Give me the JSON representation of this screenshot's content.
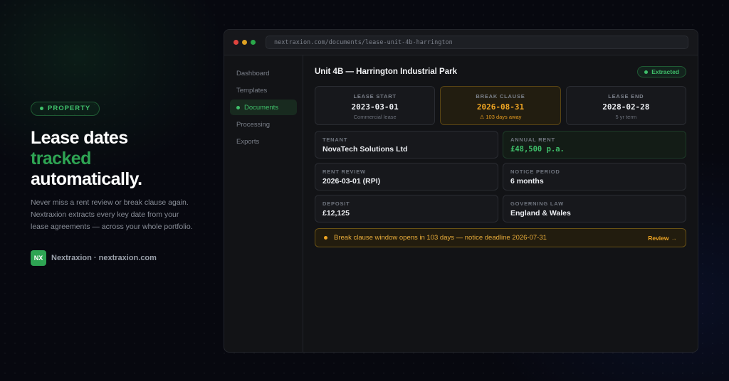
{
  "hero": {
    "badge": "PROPERTY",
    "headline_1": "Lease dates",
    "headline_2": "tracked",
    "headline_3": "automatically.",
    "description": "Never miss a rent review or break clause again. Nextraxion extracts every key date from your lease agreements — across your whole portfolio.",
    "logo_text": "NX",
    "brand": "Nextraxion · nextraxion.com"
  },
  "browser": {
    "url": "nextraxion.com/documents/lease-unit-4b-harrington",
    "traffic_lights": [
      "#e0443e",
      "#dea123",
      "#2aa84a"
    ]
  },
  "sidebar": {
    "items": [
      {
        "label": "Dashboard",
        "active": false
      },
      {
        "label": "Templates",
        "active": false
      },
      {
        "label": "Documents",
        "active": true
      },
      {
        "label": "Processing",
        "active": false
      },
      {
        "label": "Exports",
        "active": false
      }
    ]
  },
  "document": {
    "title": "Unit 4B — Harrington Industrial Park",
    "status": "Extracted",
    "dates": [
      {
        "label": "LEASE START",
        "value": "2023-03-01",
        "sub": "Commercial lease"
      },
      {
        "label": "BREAK CLAUSE",
        "value": "2026-08-31",
        "sub": "⚠ 103 days away"
      },
      {
        "label": "LEASE END",
        "value": "2028-02-28",
        "sub": "5 yr term"
      }
    ],
    "fields": [
      {
        "label": "TENANT",
        "value": "NovaTech Solutions Ltd"
      },
      {
        "label": "ANNUAL RENT",
        "value": "£48,500 p.a."
      },
      {
        "label": "RENT REVIEW",
        "value": "2026-03-01 (RPI)"
      },
      {
        "label": "NOTICE PERIOD",
        "value": "6 months"
      },
      {
        "label": "DEPOSIT",
        "value": "£12,125"
      },
      {
        "label": "GOVERNING LAW",
        "value": "England & Wales"
      }
    ],
    "alert": {
      "message": "Break clause window opens in 103 days — notice deadline 2026-07-31",
      "action": "Review",
      "action_arrow": "→"
    }
  },
  "colors": {
    "accent_green": "#2ea453",
    "warning_amber": "#f0a623"
  }
}
